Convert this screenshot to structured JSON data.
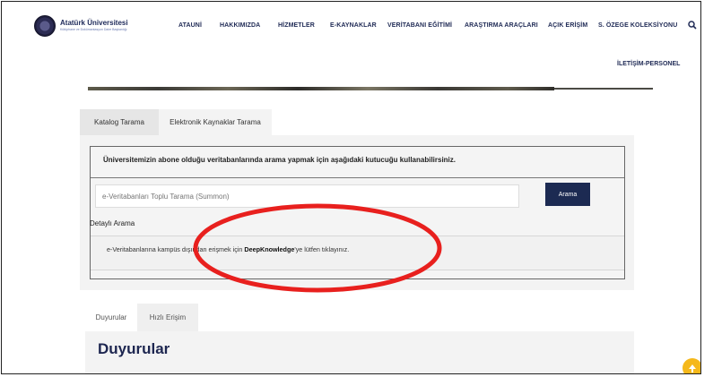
{
  "header": {
    "logo_title": "Atatürk Üniversitesi",
    "logo_subtitle": "Kütüphane ve Dokümantasyon Daire Başkanlığı",
    "nav": [
      "ATAUNİ",
      "HAKKIMIZDA",
      "HİZMETLER",
      "E-KAYNAKLAR",
      "VERİTABANI EĞİTİMİ",
      "ARAŞTIRMA ARAÇLARI",
      "AÇIK ERİŞİM",
      "S. ÖZEGE KOLEKSİYONU"
    ],
    "nav2": "İLETİŞİM-PERSONEL",
    "search_icon": "search-icon"
  },
  "search_tabs": {
    "katalog": "Katalog Tarama",
    "elektronik": "Elektronik Kaynaklar Tarama"
  },
  "search_panel": {
    "heading": "Üniversitemizin abone olduğu veritabanlarında arama yapmak için aşağıdaki kutucuğu kullanabilirsiniz.",
    "placeholder": "e-Veritabanları Toplu Tarama (Summon)",
    "button": "Arama",
    "advanced": "Detaylı Arama",
    "remote_pre": "e-Veritabanlarına kampüs dışından erişmek için ",
    "remote_link": "DeepKnowledge",
    "remote_post": "'ye lütfen tıklayınız."
  },
  "bottom_tabs": {
    "duyurular": "Duyurular",
    "hizli": "Hızlı Erişim"
  },
  "duyurular_title": "Duyurular",
  "colors": {
    "navy": "#1c2a52",
    "accent_yellow": "#f5b81a",
    "annotation_red": "#e8201e"
  }
}
